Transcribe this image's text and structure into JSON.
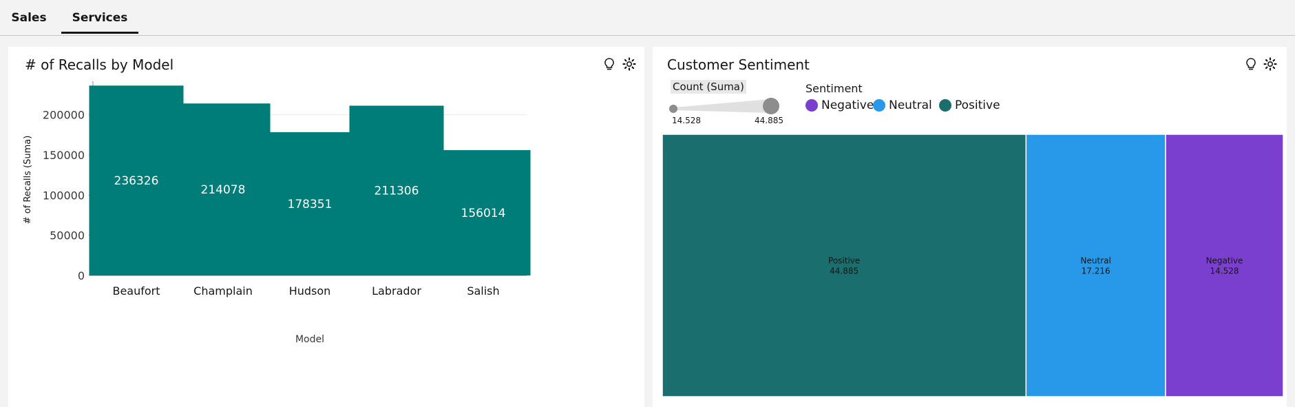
{
  "tabs": [
    {
      "label": "Sales"
    },
    {
      "label": "Services"
    }
  ],
  "icons": {
    "lightbulb": "lightbulb-icon",
    "settings": "settings-icon"
  },
  "colors": {
    "bar": "#007d79",
    "positive": "#1b6e6e",
    "neutral": "#2899e8",
    "negative": "#7b3fcf"
  },
  "recalls_panel": {
    "title": "# of Recalls by Model"
  },
  "sentiment_panel": {
    "title": "Customer Sentiment",
    "size_legend": {
      "title": "Count (Suma)",
      "min": "14.528",
      "max": "44.885"
    },
    "legend_title": "Sentiment",
    "legend": [
      {
        "label": "Negative",
        "color": "#7b3fcf"
      },
      {
        "label": "Neutral",
        "color": "#2899e8"
      },
      {
        "label": "Positive",
        "color": "#1b6e6e"
      }
    ]
  },
  "chart_data": [
    {
      "type": "bar",
      "title": "# of Recalls by Model",
      "xlabel": "Model",
      "ylabel": "# of Recalls (Suma)",
      "categories": [
        "Beaufort",
        "Champlain",
        "Hudson",
        "Labrador",
        "Salish"
      ],
      "values": [
        236326,
        214078,
        178351,
        211306,
        156014
      ],
      "value_labels": [
        "236326",
        "214078",
        "178351",
        "211306",
        "156014"
      ],
      "ylim": [
        0,
        240000
      ],
      "yticks": [
        0,
        50000,
        100000,
        150000,
        200000
      ],
      "ytick_labels": [
        "0",
        "50000",
        "100000",
        "150000",
        "200000"
      ],
      "grid": true
    },
    {
      "type": "treemap",
      "title": "Customer Sentiment",
      "items": [
        {
          "name": "Positive",
          "value": 44.885,
          "value_label": "44.885",
          "color": "#1b6e6e"
        },
        {
          "name": "Neutral",
          "value": 17.216,
          "value_label": "17.216",
          "color": "#2899e8"
        },
        {
          "name": "Negative",
          "value": 14.528,
          "value_label": "14.528",
          "color": "#7b3fcf"
        }
      ]
    }
  ]
}
